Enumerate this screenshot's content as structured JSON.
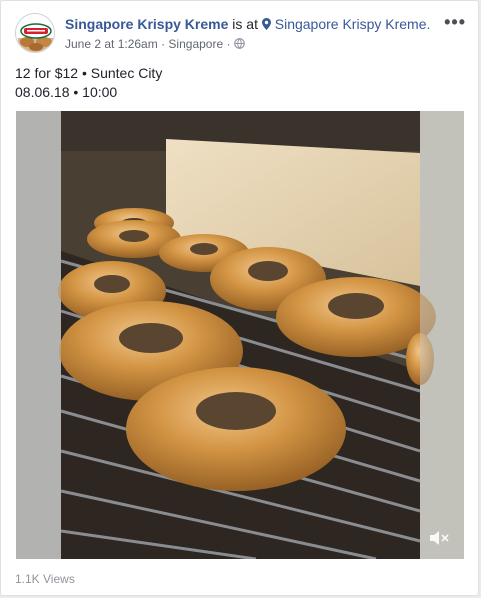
{
  "post": {
    "page_name": "Singapore Krispy Kreme",
    "is_at": "is at",
    "place_name": "Singapore Krispy Kreme.",
    "date": "June 2 at 1:26am",
    "sep": "·",
    "location": "Singapore",
    "sep2": "·",
    "text_line1": "12 for $12 • Suntec City",
    "text_line2": "08.06.18 • 10:00",
    "views": "1.1K Views",
    "more": "•••"
  },
  "icons": {
    "avatar": "krispy-kreme-logo",
    "place": "map-pin-icon",
    "privacy": "globe-icon",
    "mute": "speaker-muted-icon"
  },
  "colors": {
    "link": "#385898",
    "meta": "#616770",
    "views": "#90949c",
    "glaze": "#c98a3a"
  }
}
